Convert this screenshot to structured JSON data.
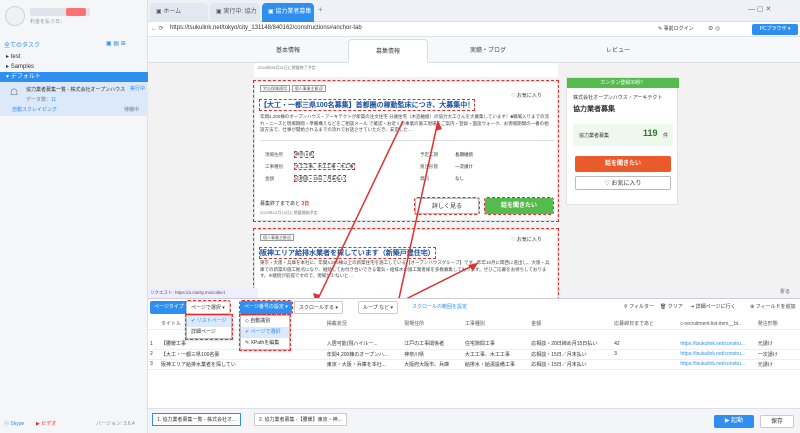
{
  "sidebar": {
    "user_sub": "料金を払う日：",
    "all_tasks": "全てのタスク",
    "folders": [
      "test",
      "Samples"
    ],
    "group": "デフォルト",
    "task": {
      "title": "協力業者募集一覧 - 株式会社オープンハウス・アーキテクト",
      "data_label": "データ数：",
      "data_count": "11",
      "status": "実行中",
      "action": "自動スクレイピング",
      "action_status": "待機中"
    },
    "footer": {
      "skype": "Skype",
      "mail": "ビデオ",
      "version": "バージョン: 3.6.4"
    }
  },
  "browser": {
    "tabs": [
      "ホーム",
      "実行中: 協力",
      "協力業者募集"
    ],
    "url": "https://tsukulink.net/tokyo/city_131148/840162/constructions#anchor-tab",
    "login": "事前ログイン",
    "pc": "PCブラウザ",
    "status_url": "リクエスト: https://a.clarity.ms/collect",
    "collapse": "折る"
  },
  "web": {
    "tabs": [
      "基本情報",
      "募集情報",
      "実績・ブログ",
      "レビュー"
    ],
    "card1": {
      "date": "2024年05月13日に掲載終了予定",
      "tags": [
        "労災保険適用",
        "個人事業主歓迎"
      ],
      "title": "【大工・一都三県100名募集】首都圏の稼動監床につき、大募集中！",
      "fav": "お気に入り",
      "body": "年間4,200棟のオープンハウス・アーキテクトが新築の注文住宅 分譲住宅（木造軸組）の協力大工さんを大募集しています！■職場入りまでの流れ・ニーズと現場期間・準備構えなどをご相談メール で確認・お近くの事業の施工現場をご案内・登録・面談ウォーク、お現場期間の一番の相談方法で、仕事が開始されるまでの流れでお話させていただき、安定した…",
      "rows": [
        [
          "現場住所",
          "神奈川県",
          "予定工期",
          "長期継続"
        ],
        [
          "工事種別",
          "大工工事、木工工事・木工事",
          "買注形態",
          "一次請け"
        ],
        [
          "金額",
          "応相談・15日／月末払い",
          "資料",
          "なし"
        ]
      ],
      "deadline": "募集終了まであと",
      "deadline_days": "3日",
      "posted": "2023年12月13日に掲載開始予定",
      "detail": "詳しく見る",
      "ask": "話を聞きたい"
    },
    "card2": {
      "tag": "個人事業主歓迎",
      "title": "阪神エリア給排水業者を探しています（新築戸建住宅）",
      "fav": "お気に入り",
      "body": "東京・大阪・兵庫を本社に、年間4,200棟以上の新築住宅を施工している【オープンハウスグループ】です。昨年10月に関西に進出し、大阪・兵庫での新築の施工拠点になり、継続してお付き合いできる電気・給排水の施工業者様を多数募集しております。ぜひご応募をお待ちしております。※継続が前提ですので、現場が少ないと…"
    },
    "right": {
      "badge": "カンタン登録30秒！",
      "company": "株式会社オープンハウス・アーキテクト",
      "recruit": "協力業者募集",
      "count_label": "協力業者募集",
      "count": "119",
      "unit": "件",
      "ask": "話を聞きたい",
      "fav": "お気に入り"
    }
  },
  "toolbar": {
    "page_type": "ページタイプ",
    "page_select": "ページで選択",
    "page_select2": "ページ番号の設定",
    "scroll": "スクロールする",
    "loop": "ループ など",
    "scroll_set": "スクロールの範囲を設定",
    "filter": "フィルター",
    "clear": "クリア",
    "detail_link": "詳細ページに行く",
    "add_field": "フィールドを追加"
  },
  "menu1": {
    "items": [
      "リストページ",
      "詳細ページ"
    ]
  },
  "menu2": {
    "items": [
      "自動識別",
      "ページで選択",
      "XPathを編集"
    ]
  },
  "grid": {
    "headers": [
      "",
      "タイトル",
      "",
      "",
      "掲載状況",
      "現場住所",
      "工事種別",
      "金額",
      "応募締日まであと",
      "c-recruitment-list-item__bt..",
      "発注形態"
    ],
    "rows": [
      [
        "1",
        "【腰暖工事",
        "",
        "",
        "入居可能(現ハイルー...",
        "江戸の工事関係者",
        "住宅隙間工事",
        "応相談・20日締め月15日払い",
        "42",
        "https://tsukulink.net/constru...",
        "元請け"
      ],
      [
        "2",
        "【大工・一都三県100名募",
        "",
        "",
        "年間4,200棟のオープンハ...",
        "神奈川県",
        "大工工事、木工工事",
        "応相談・15日／月末払い",
        "3",
        "https://tsukulink.net/constru...",
        "一次請け"
      ],
      [
        "3",
        "阪神エリア給排水業者を探しています",
        "",
        "",
        "東京・大阪・兵庫を本社...",
        "大阪府大阪市、兵庫",
        "給排水・給湯設備工事",
        "応相談・15日／月末払い",
        "",
        "https://tsukulink.net/constru...",
        "元請け"
      ]
    ]
  },
  "footer": {
    "tabs": [
      "1. 協力業者募集一覧 - 株式会社オ...",
      "2. 協力業者募集 -【腰暖】東京・神..."
    ],
    "start": "▶ 起動",
    "save": "保存"
  },
  "colors": {
    "accent": "#2f8ff0",
    "green": "#55bb4f",
    "red": "#e03030"
  }
}
